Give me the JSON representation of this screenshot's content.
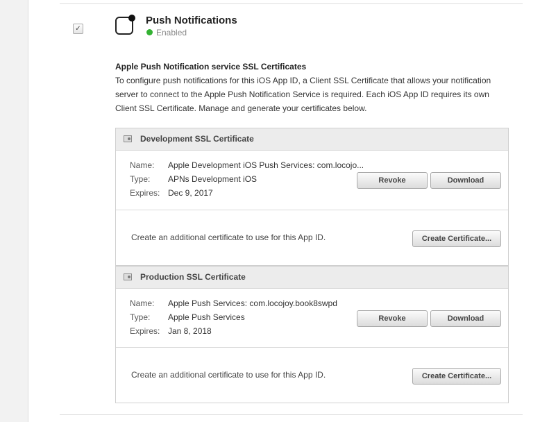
{
  "service": {
    "title": "Push Notifications",
    "status": "Enabled",
    "checkbox_mark": "✓",
    "status_color": "#34b233"
  },
  "description": {
    "title": "Apple Push Notification service SSL Certificates",
    "body": "To configure push notifications for this iOS App ID, a Client SSL Certificate that allows your notification server to connect to the Apple Push Notification Service is required. Each iOS App ID requires its own Client SSL Certificate. Manage and generate your certificates below."
  },
  "labels": {
    "name": "Name:",
    "type": "Type:",
    "expires": "Expires:"
  },
  "development": {
    "header": "Development SSL Certificate",
    "name": "Apple Development iOS Push Services: com.locojo...",
    "type": "APNs Development iOS",
    "expires": "Dec 9, 2017",
    "revoke_label": "Revoke",
    "download_label": "Download",
    "create_text": "Create an additional certificate to use for this App ID.",
    "create_label": "Create Certificate..."
  },
  "production": {
    "header": "Production SSL Certificate",
    "name": "Apple Push Services: com.locojoy.book8swpd",
    "type": "Apple Push Services",
    "expires": "Jan 8, 2018",
    "revoke_label": "Revoke",
    "download_label": "Download",
    "create_text": "Create an additional certificate to use for this App ID.",
    "create_label": "Create Certificate..."
  },
  "icons": {
    "service": "push-notifications-icon",
    "certificate": "certificate-icon"
  }
}
